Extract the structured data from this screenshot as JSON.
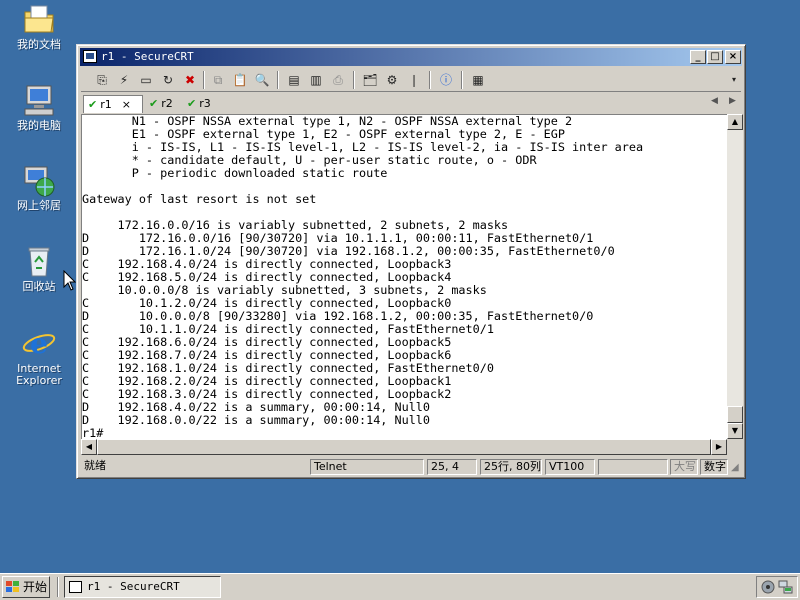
{
  "desktop": {
    "icons": [
      {
        "label": "我的文档"
      },
      {
        "label": "我的电脑"
      },
      {
        "label": "网上邻居"
      },
      {
        "label": "回收站"
      },
      {
        "label": "Internet Explorer"
      }
    ]
  },
  "window": {
    "title": "r1 - SecureCRT",
    "tabs": [
      {
        "label": "r1",
        "active": true
      },
      {
        "label": "r2",
        "active": false
      },
      {
        "label": "r3",
        "active": false
      }
    ],
    "tab_close": "×"
  },
  "terminal": {
    "lines": [
      "       N1 - OSPF NSSA external type 1, N2 - OSPF NSSA external type 2",
      "       E1 - OSPF external type 1, E2 - OSPF external type 2, E - EGP",
      "       i - IS-IS, L1 - IS-IS level-1, L2 - IS-IS level-2, ia - IS-IS inter area",
      "       * - candidate default, U - per-user static route, o - ODR",
      "       P - periodic downloaded static route",
      "",
      "Gateway of last resort is not set",
      "",
      "     172.16.0.0/16 is variably subnetted, 2 subnets, 2 masks",
      "D       172.16.0.0/16 [90/30720] via 10.1.1.1, 00:00:11, FastEthernet0/1",
      "D       172.16.1.0/24 [90/30720] via 192.168.1.2, 00:00:35, FastEthernet0/0",
      "C    192.168.4.0/24 is directly connected, Loopback3",
      "C    192.168.5.0/24 is directly connected, Loopback4",
      "     10.0.0.0/8 is variably subnetted, 3 subnets, 2 masks",
      "C       10.1.2.0/24 is directly connected, Loopback0",
      "D       10.0.0.0/8 [90/33280] via 192.168.1.2, 00:00:35, FastEthernet0/0",
      "C       10.1.1.0/24 is directly connected, FastEthernet0/1",
      "C    192.168.6.0/24 is directly connected, Loopback5",
      "C    192.168.7.0/24 is directly connected, Loopback6",
      "C    192.168.1.0/24 is directly connected, FastEthernet0/0",
      "C    192.168.2.0/24 is directly connected, Loopback1",
      "C    192.168.3.0/24 is directly connected, Loopback2",
      "D    192.168.4.0/22 is a summary, 00:00:14, Null0",
      "D    192.168.0.0/22 is a summary, 00:00:14, Null0",
      "r1#"
    ]
  },
  "status": {
    "ready": "就绪",
    "protocol": "Telnet",
    "cursor": "25,  4",
    "size": "25行, 80列",
    "emulation": "VT100",
    "caps": "大写",
    "num": "数字"
  },
  "taskbar": {
    "start_label": "开始",
    "task_item": "r1 - SecureCRT"
  },
  "colors": {
    "desktop": "#3a6ea5",
    "title_active_left": "#0a246a",
    "title_active_right": "#a6caf0",
    "tab_check": "#1b9b1b"
  }
}
